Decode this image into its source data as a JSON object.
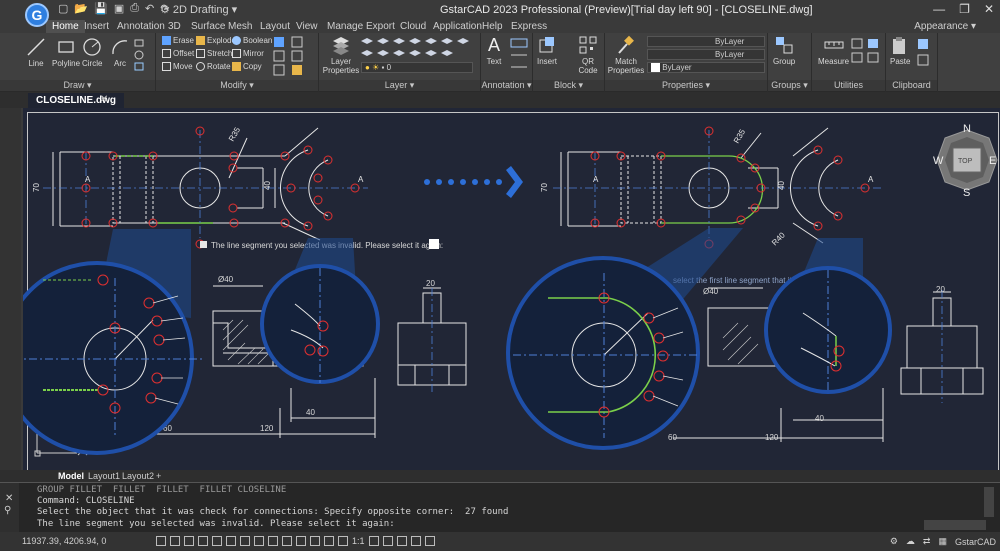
{
  "app": {
    "logo_letter": "G",
    "workspace": "2D Drafting",
    "title": "GstarCAD 2023 Professional (Preview)[Trial day left 90] - [CLOSELINE.dwg]",
    "window_controls": [
      "—",
      "❐",
      "✕"
    ]
  },
  "ribbon_tabs": [
    "Home",
    "Insert",
    "Annotation",
    "3D",
    "Surface",
    "Mesh",
    "Layout",
    "View",
    "Manage",
    "Export",
    "Cloud",
    "Application",
    "Help",
    "Express"
  ],
  "appearance_label": "Appearance",
  "panels": {
    "draw": {
      "label": "Draw",
      "buttons": [
        "Line",
        "Polyline",
        "Circle",
        "Arc"
      ]
    },
    "modify": {
      "label": "Modify",
      "buttons": [
        "Erase",
        "Explode",
        "Boolean",
        "Offset",
        "Stretch",
        "Mirror",
        "Move",
        "Rotate",
        "Copy"
      ]
    },
    "layer": {
      "label": "Layer",
      "button": "Layer Properties",
      "layer_value": "0"
    },
    "annotation": {
      "label": "Annotation",
      "button": "Text"
    },
    "block": {
      "label": "Block",
      "buttons": [
        "Insert",
        "QR Code"
      ]
    },
    "properties": {
      "label": "Properties",
      "button": "Match Properties",
      "values": [
        "ByLayer",
        "ByLayer",
        "ByLayer"
      ]
    },
    "groups": {
      "label": "Groups",
      "button": "Group"
    },
    "utilities": {
      "label": "Utilities",
      "button": "Measure"
    },
    "clipboard": {
      "label": "Clipboard",
      "button": "Paste"
    }
  },
  "document_tab": "CLOSELINE.dwg",
  "canvas": {
    "prompt_left": "The line segment you selected was invalid. Please select it again:",
    "prompt_right": "select the first line segment that it was connected:",
    "viewcube": {
      "n": "N",
      "s": "S",
      "e": "E",
      "w": "W",
      "top": "TOP"
    },
    "dims": {
      "d70": "70",
      "d40": "40",
      "r35": "R35",
      "r40": "R40",
      "a": "A",
      "dia40": "Ø40",
      "d20": "20",
      "d60": "60",
      "d120": "120",
      "d40b": "40"
    }
  },
  "layout_tabs": [
    "Model",
    "Layout1",
    "Layout2",
    "+"
  ],
  "command": {
    "lines": [
      "GROUP FILLET  FILLET  FILLET  FILLET CLOSELINE",
      "Command: CLOSELINE",
      "Select the object that it was check for connections: Specify opposite corner:  27 found",
      "The line segment you selected was invalid. Please select it again:"
    ]
  },
  "status": {
    "coords": "11937.39, 4206.94, 0",
    "scale": "1:1",
    "brand": "GstarCAD"
  }
}
